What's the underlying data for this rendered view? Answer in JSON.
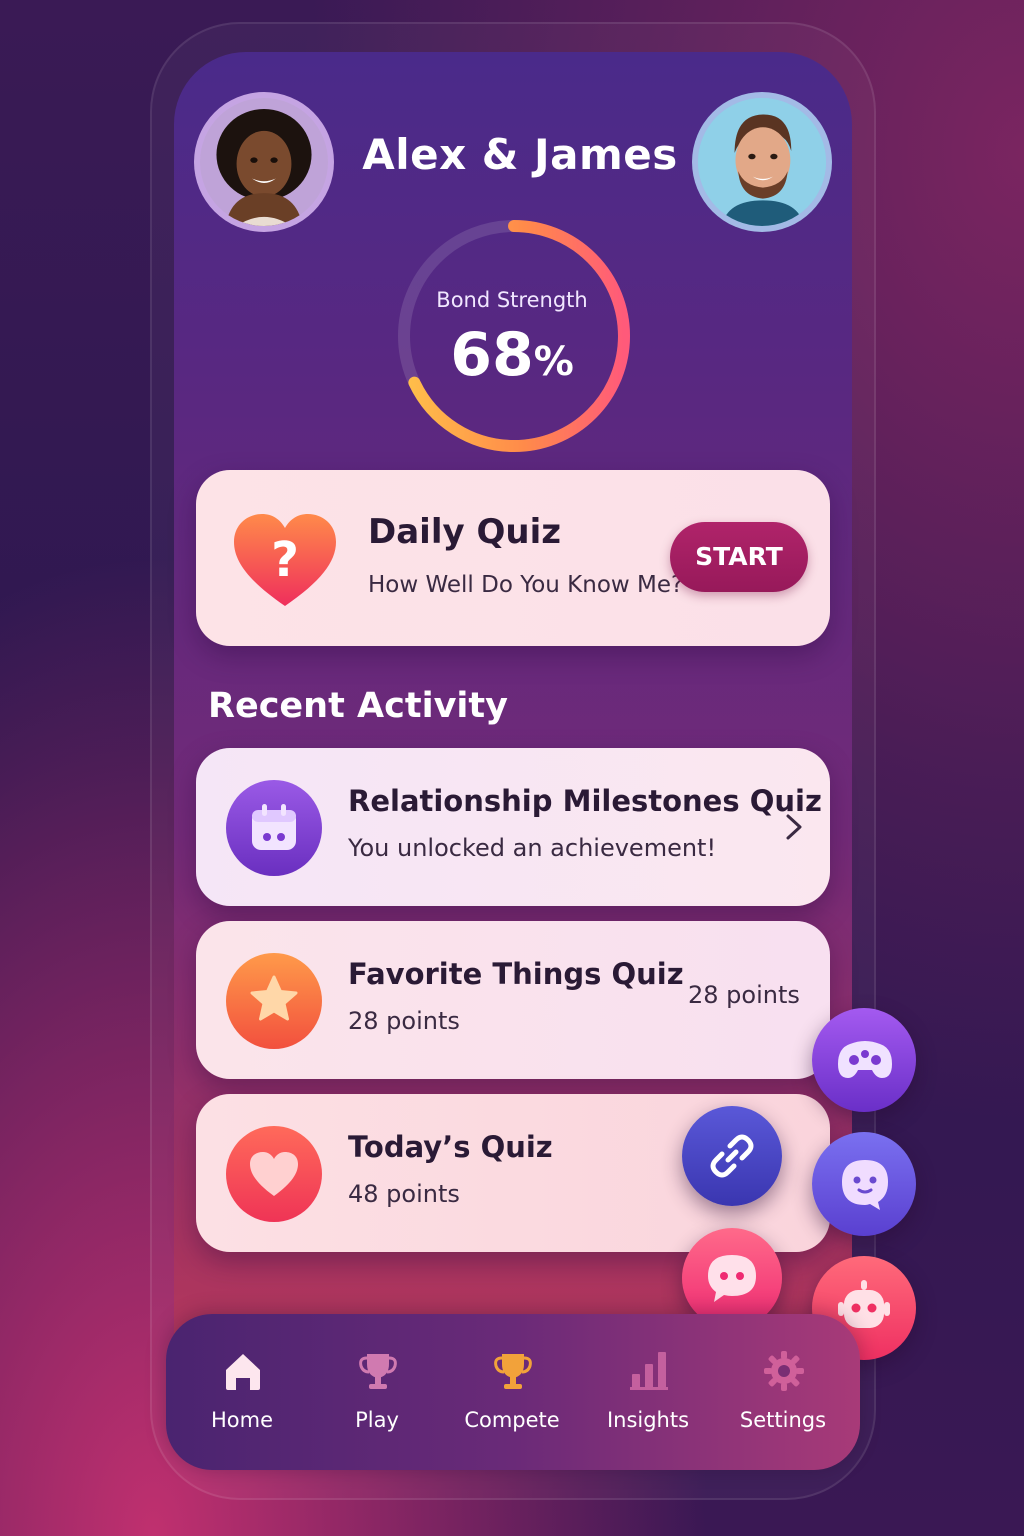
{
  "header": {
    "title": "Alex & James",
    "left_avatar": "avatar-person-left",
    "right_avatar": "avatar-person-right"
  },
  "bond": {
    "label": "Bond Strength",
    "value": "68",
    "unit": "%",
    "fraction": 0.68
  },
  "daily_quiz": {
    "title": "Daily Quiz",
    "subtitle": "How Well Do You Know Me?",
    "button": "START",
    "icon": "heart-question-icon"
  },
  "recent": {
    "title": "Recent Activity",
    "items": [
      {
        "title": "Relationship Milestones Quiz",
        "subtitle": "You unlocked an achievement!",
        "icon": "calendar-icon"
      },
      {
        "title": "Favorite Things Quiz",
        "subtitle": "28 points",
        "side": "28 points",
        "icon": "star-icon"
      },
      {
        "title": "Today’s Quiz",
        "subtitle": "48 points",
        "icon": "heart-icon"
      }
    ]
  },
  "fabs": [
    "gamepad-icon",
    "link-icon",
    "face-chat-icon",
    "chat-bubble-icon",
    "robot-icon"
  ],
  "nav": {
    "items": [
      {
        "label": "Home",
        "icon": "home-icon"
      },
      {
        "label": "Play",
        "icon": "trophy-icon"
      },
      {
        "label": "Compete",
        "icon": "cup-icon"
      },
      {
        "label": "Insights",
        "icon": "bar-chart-icon"
      },
      {
        "label": "Settings",
        "icon": "gear-icon"
      }
    ]
  },
  "colors": {
    "accent": "#9a1b5e",
    "gauge_start": "#ffc04a",
    "gauge_end": "#ff5a7a"
  }
}
